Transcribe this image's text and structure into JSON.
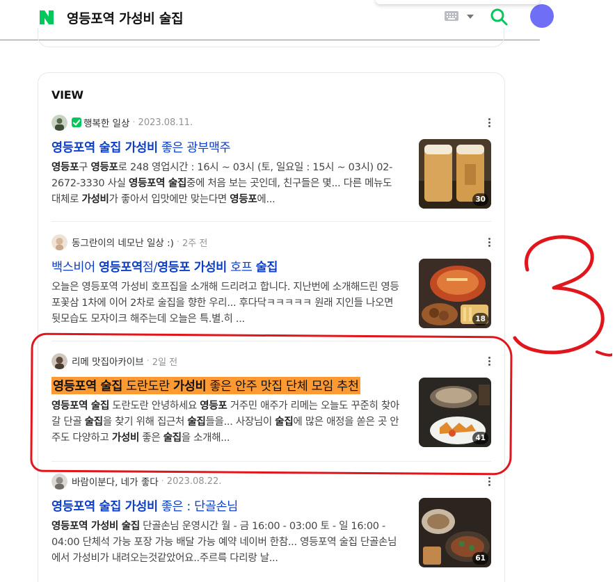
{
  "header": {
    "query": "영등포역 가성비 술집",
    "colors": {
      "naver_green": "#03c75a",
      "link_blue": "#0c3ec8",
      "highlight_orange": "#ff9a33",
      "annotation_red": "#e0161c"
    }
  },
  "view": {
    "section_title": "VIEW",
    "items": [
      {
        "author": "행복한 일상",
        "verified": true,
        "date": "2023.08.11.",
        "title_parts": [
          {
            "t": "영등포역 술집 가성비",
            "b": true
          },
          {
            "t": " 좋은 광부맥주",
            "b": false
          }
        ],
        "desc_parts": [
          {
            "t": "영등포",
            "b": true
          },
          {
            "t": "구 ",
            "b": false
          },
          {
            "t": "영등포",
            "b": true
          },
          {
            "t": "로 248 영업시간 : 16시 ~ 03시 (토, 일요일 : 15시 ~ 03시) 02-2672-3330 사실 ",
            "b": false
          },
          {
            "t": "영등포역 술집",
            "b": true
          },
          {
            "t": "중에 처음 보는 곳인데, 친구들은 몇... 다른 메뉴도 대체로 ",
            "b": false
          },
          {
            "t": "가성비",
            "b": true
          },
          {
            "t": "가 좋아서 입맛에만 맞는다면 ",
            "b": false
          },
          {
            "t": "영등포",
            "b": true
          },
          {
            "t": "에...",
            "b": false
          }
        ],
        "photo_count": "30",
        "thumb_icon": "beer-photo"
      },
      {
        "author": "동그란이의 네모난 일상 :)",
        "verified": false,
        "date": "2주 전",
        "title_parts": [
          {
            "t": "백스비어 ",
            "b": false
          },
          {
            "t": "영등포역",
            "b": true
          },
          {
            "t": "점/",
            "b": false
          },
          {
            "t": "영등포 가성비",
            "b": true
          },
          {
            "t": " 호프 ",
            "b": false
          },
          {
            "t": "술집",
            "b": true
          }
        ],
        "desc_parts": [
          {
            "t": "오늘은 영등포역 가성비 호프집을 소개해 드리려고 합니다. 지난번에 소개해드린 영등포꽃삼 1차에 이어 2차로 술집을 향한 우리... 후다닥ㅋㅋㅋㅋㅋ 원래 지인들 나오면 뒷모습도 모자이크 해주는데 오늘은 특.별.히 ...",
            "b": false
          }
        ],
        "photo_count": "18",
        "thumb_icon": "pub-food-photo"
      },
      {
        "author": "리메 맛집아카이브",
        "verified": false,
        "date": "2일 전",
        "title_parts": [
          {
            "t": "영등포역 술집",
            "b": true
          },
          {
            "t": " 도란도란 ",
            "b": false
          },
          {
            "t": "가성비",
            "b": true
          },
          {
            "t": " 좋은 안주 맛집 단체 모임 추천",
            "b": false
          }
        ],
        "desc_parts": [
          {
            "t": "영등포역 술집",
            "b": true
          },
          {
            "t": " 도란도란 안녕하세요 ",
            "b": false
          },
          {
            "t": "영등포",
            "b": true
          },
          {
            "t": " 거주민 애주가 리메는 오늘도 꾸준히 찾아갈 단골 ",
            "b": false
          },
          {
            "t": "술집",
            "b": true
          },
          {
            "t": "을 찾기 위해 집근처 ",
            "b": false
          },
          {
            "t": "술집",
            "b": true
          },
          {
            "t": "들을... 사장님이 ",
            "b": false
          },
          {
            "t": "술집",
            "b": true
          },
          {
            "t": "에 많은 애정을 쏟은 곳 안주도 다양하고 ",
            "b": false
          },
          {
            "t": "가성비",
            "b": true
          },
          {
            "t": " 좋은 ",
            "b": false
          },
          {
            "t": "술집",
            "b": true
          },
          {
            "t": "을 소개해...",
            "b": false
          }
        ],
        "photo_count": "41",
        "thumb_icon": "anju-photo",
        "highlighted": true
      },
      {
        "author": "바람이분다, 네가 좋다",
        "verified": false,
        "date": "2023.08.22.",
        "title_parts": [
          {
            "t": "영등포역 술집 가성비",
            "b": true
          },
          {
            "t": " 좋은 : 단골손님",
            "b": false
          }
        ],
        "desc_parts": [
          {
            "t": "영등포역 가성비 술집",
            "b": true
          },
          {
            "t": " 단골손님 운영시간 월 - 금 16:00 - 03:00 토 - 일 16:00 - 04:00 단체석 가능 포장 가능 배달 가능 예약 네이버 한참... 영등포역 술집 단골손님에서 가성비가 내려오는것같았어요..주르륵 다리랑 날...",
            "b": false
          }
        ],
        "photo_count": "61",
        "thumb_icon": "food-plates-photo"
      }
    ]
  },
  "annotation": {
    "label": "3"
  }
}
